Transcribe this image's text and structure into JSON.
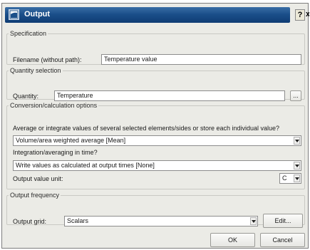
{
  "window": {
    "title": "Output",
    "help_label": "?",
    "close_label": "x"
  },
  "specification": {
    "legend": "Specification",
    "filename_label": "Filename (without path):",
    "filename_value": "Temperature value"
  },
  "quantity": {
    "legend": "Quantity selection",
    "label": "Quantity:",
    "value": "Temperature",
    "browse_label": "..."
  },
  "conversion": {
    "legend": "Conversion/calculation options",
    "question1": "Average or integrate values of several selected elements/sides or store each individual value?",
    "select1_value": "Volume/area weighted average [Mean]",
    "question2": "Integration/averaging in time?",
    "select2_value": "Write values as calculated at output times [None]",
    "unit_label": "Output value unit:",
    "unit_value": "C"
  },
  "frequency": {
    "legend": "Output frequency",
    "grid_label": "Output grid:",
    "grid_value": "Scalars",
    "edit_label": "Edit..."
  },
  "footer": {
    "ok_label": "OK",
    "cancel_label": "Cancel"
  },
  "colors": {
    "titlebar": "#1b4f8a",
    "dialog_background": "#ebebe6"
  },
  "icons": [
    "window-app-icon",
    "chevron-down-icon"
  ]
}
